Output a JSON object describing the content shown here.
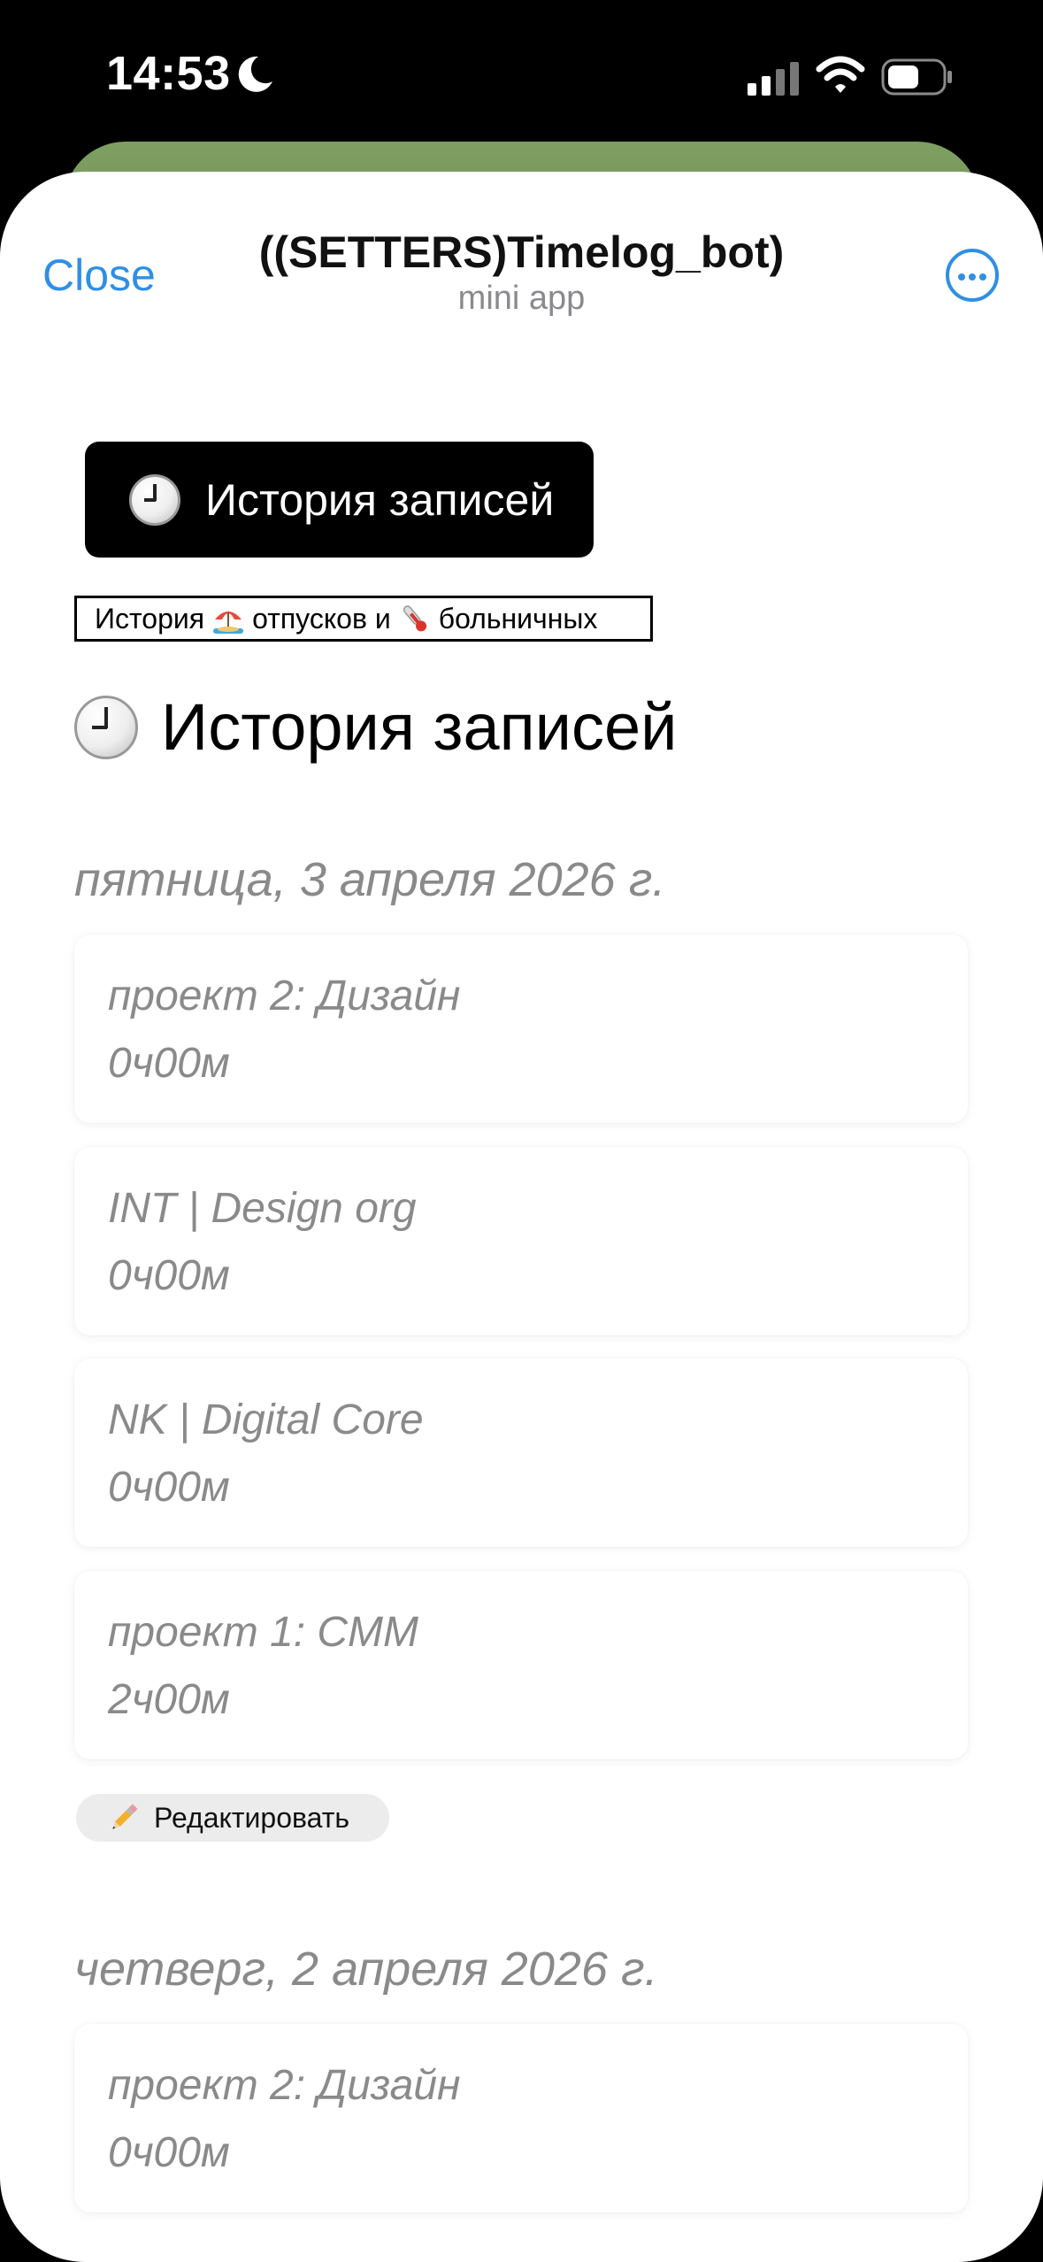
{
  "status_bar": {
    "time": "14:53"
  },
  "nav": {
    "close_label": "Close",
    "title": "((SETTERS)Timelog_bot)",
    "subtitle": "mini app"
  },
  "actions": {
    "history_button_label": "История записей",
    "vacations_link": {
      "part1": "История",
      "part2": "отпусков и",
      "part3": "больничных"
    }
  },
  "section": {
    "title": "История записей"
  },
  "days": [
    {
      "date": "пятница, 3 апреля 2026 г.",
      "entries": [
        {
          "project": "проект 2: Дизайн",
          "duration": "0ч00м"
        },
        {
          "project": "INT | Design org",
          "duration": "0ч00м"
        },
        {
          "project": "NK | Digital Core",
          "duration": "0ч00м"
        },
        {
          "project": "проект 1: CMM",
          "duration": "2ч00м"
        }
      ],
      "edit_label": "Редактировать"
    },
    {
      "date": "четверг, 2 апреля 2026 г.",
      "entries": [
        {
          "project": "проект 2: Дизайн",
          "duration": "0ч00м"
        }
      ]
    }
  ],
  "colors": {
    "accent": "#2f8fe5",
    "muted_text": "#8a8a8a",
    "primary_button_bg": "#000000",
    "edit_button_bg": "#ececec"
  },
  "icons": {
    "status": [
      "moon-icon",
      "cellular-signal-icon",
      "wifi-icon",
      "battery-icon"
    ],
    "nav": [
      "more-options-icon"
    ],
    "content": [
      "clock-icon",
      "beach-umbrella-icon",
      "thermometer-icon",
      "pencil-icon"
    ]
  }
}
